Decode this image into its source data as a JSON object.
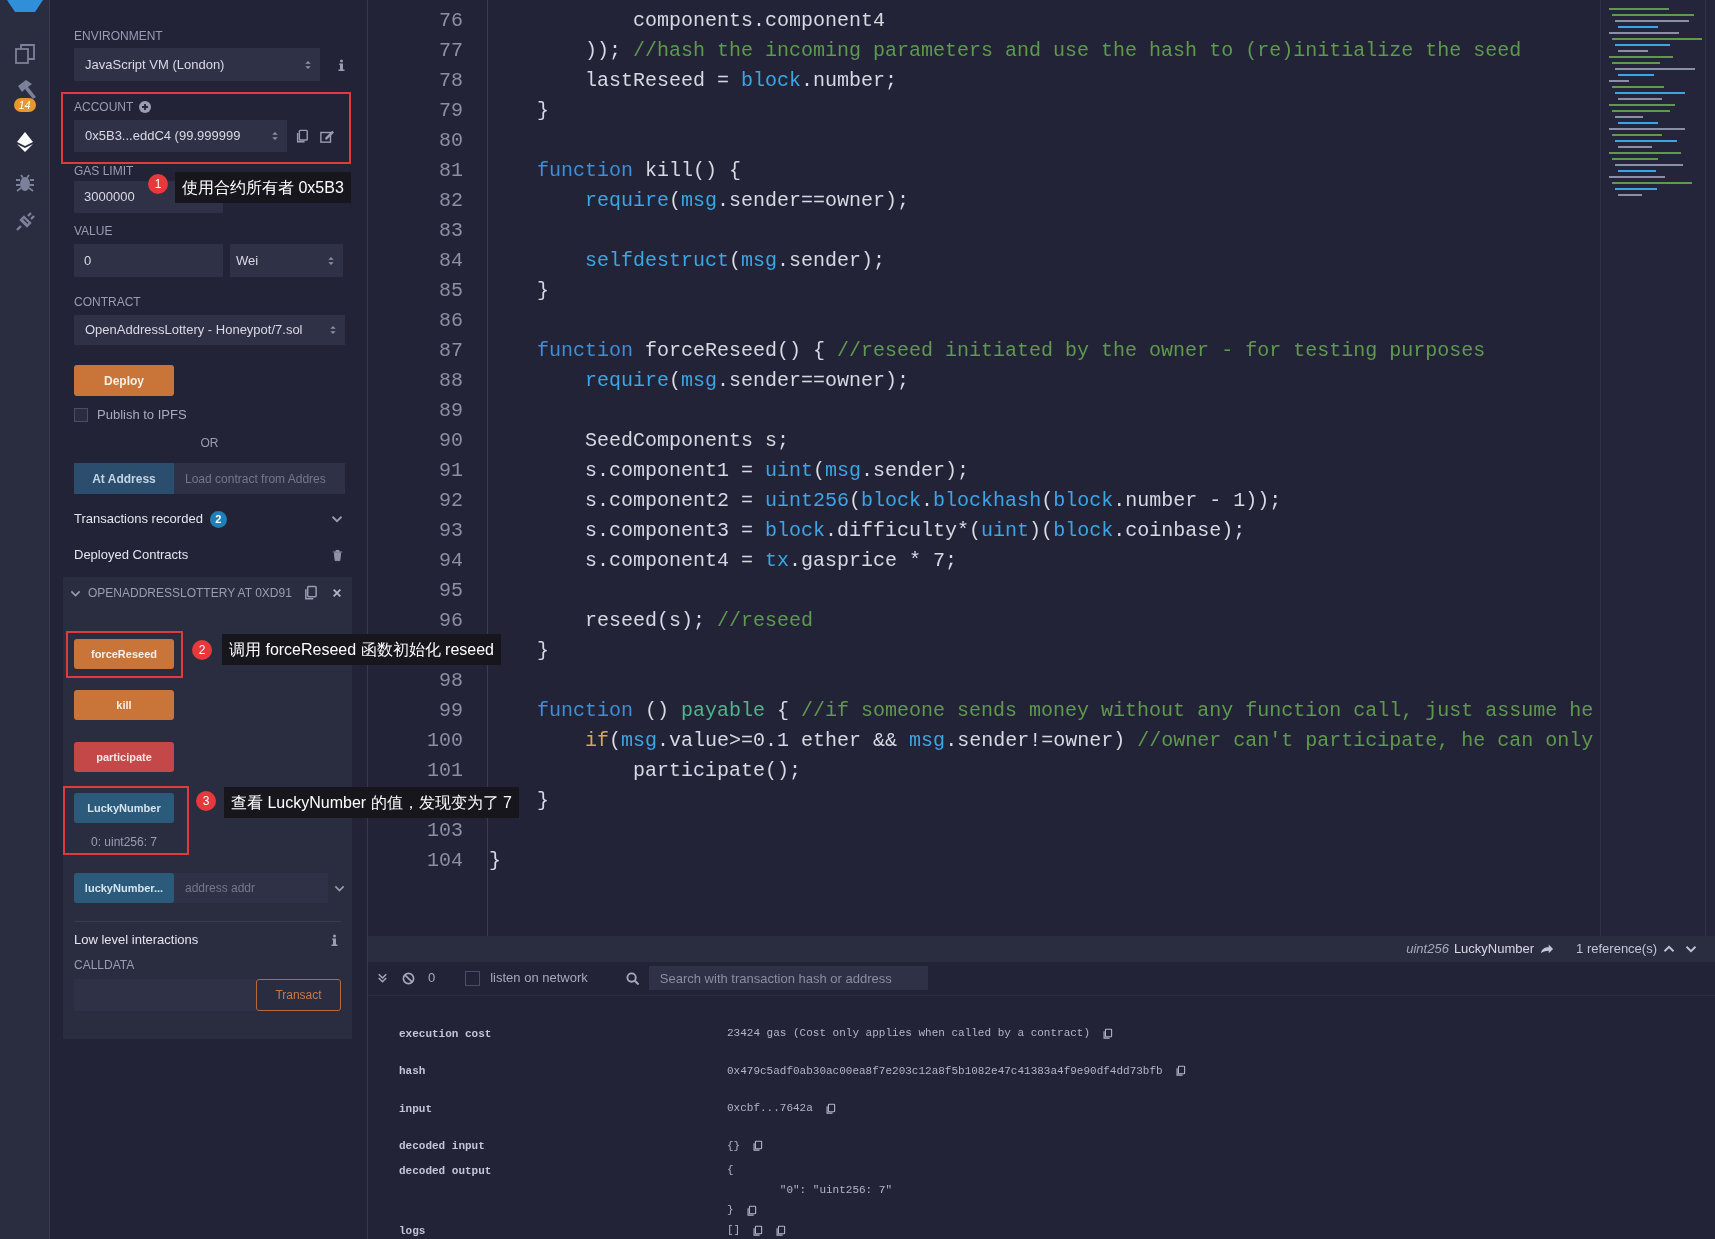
{
  "icon_bar": {
    "items": [
      {
        "kind": "files",
        "selected": false
      },
      {
        "kind": "compiler",
        "selected": false,
        "badge": "14"
      },
      {
        "kind": "deploy",
        "selected": true
      },
      {
        "kind": "debugger",
        "selected": false
      },
      {
        "kind": "plugins",
        "selected": false
      }
    ]
  },
  "run_panel": {
    "environment": {
      "label": "ENVIRONMENT",
      "value": "JavaScript VM (London)"
    },
    "account": {
      "label": "ACCOUNT",
      "value": "0x5B3...eddC4 (99.999999",
      "highlighted": true
    },
    "gas_limit": {
      "label": "GAS LIMIT",
      "value": "3000000"
    },
    "value": {
      "label": "VALUE",
      "value": "0",
      "unit": "Wei"
    },
    "contract": {
      "label": "CONTRACT",
      "value": "OpenAddressLottery - Honeypot/7.sol"
    },
    "deploy_button": "Deploy",
    "publish_ipfs": {
      "label": "Publish to IPFS",
      "checked": false
    },
    "or_text": "OR",
    "at_address": {
      "button": "At Address",
      "placeholder": "Load contract from Addres"
    },
    "transactions_recorded": {
      "label": "Transactions recorded",
      "count": "2"
    },
    "deployed_contracts": {
      "label": "Deployed Contracts"
    },
    "instance": {
      "title": "OPENADDRESSLOTTERY AT 0XD91",
      "expanded": true,
      "functions": [
        {
          "label": "forceReseed",
          "kind": "transact",
          "highlighted": true
        },
        {
          "label": "kill",
          "kind": "transact",
          "highlighted": false
        },
        {
          "label": "participate",
          "kind": "payable",
          "highlighted": false
        },
        {
          "label": "LuckyNumber",
          "kind": "call",
          "highlighted": true,
          "result": "0: uint256: 7"
        },
        {
          "label": "luckyNumber...",
          "kind": "call",
          "highlighted": false,
          "placeholder": "address addr"
        }
      ]
    },
    "low_level": {
      "title": "Low level interactions",
      "calldata_label": "CALLDATA",
      "transact_button": "Transact"
    }
  },
  "annotations": [
    {
      "number": "1",
      "text": "使用合约所有者 0x5B3"
    },
    {
      "number": "2",
      "text": "调用 forceReseed 函数初始化 reseed"
    },
    {
      "number": "3",
      "text": "查看 LuckyNumber 的值，发现变为了 7"
    }
  ],
  "editor": {
    "lines": [
      {
        "number": "76",
        "tokens": [
          {
            "text": "            components.component4",
            "kind": "plain"
          }
        ]
      },
      {
        "number": "77",
        "tokens": [
          {
            "text": "        )); ",
            "kind": "plain"
          },
          {
            "text": "//hash the incoming parameters and use the hash to (re)initialize the seed",
            "kind": "comment"
          }
        ]
      },
      {
        "number": "78",
        "tokens": [
          {
            "text": "        lastReseed = ",
            "kind": "plain"
          },
          {
            "text": "block",
            "kind": "builtin"
          },
          {
            "text": ".number;",
            "kind": "plain"
          }
        ]
      },
      {
        "number": "79",
        "tokens": [
          {
            "text": "    }",
            "kind": "plain"
          }
        ]
      },
      {
        "number": "80"
      },
      {
        "number": "81",
        "tokens": [
          {
            "text": "    function",
            "kind": "keyword"
          },
          {
            "text": " kill() {",
            "kind": "plain"
          }
        ]
      },
      {
        "number": "82",
        "tokens": [
          {
            "text": "        require",
            "kind": "builtin"
          },
          {
            "text": "(",
            "kind": "plain"
          },
          {
            "text": "msg",
            "kind": "builtin"
          },
          {
            "text": ".sender==owner);",
            "kind": "plain"
          }
        ]
      },
      {
        "number": "83"
      },
      {
        "number": "84",
        "tokens": [
          {
            "text": "        selfdestruct",
            "kind": "builtin"
          },
          {
            "text": "(",
            "kind": "plain"
          },
          {
            "text": "msg",
            "kind": "builtin"
          },
          {
            "text": ".sender);",
            "kind": "plain"
          }
        ]
      },
      {
        "number": "85",
        "tokens": [
          {
            "text": "    }",
            "kind": "plain"
          }
        ]
      },
      {
        "number": "86"
      },
      {
        "number": "87",
        "tokens": [
          {
            "text": "    function",
            "kind": "keyword"
          },
          {
            "text": " forceReseed() { ",
            "kind": "plain"
          },
          {
            "text": "//reseed initiated by the owner - for testing purposes",
            "kind": "comment"
          }
        ]
      },
      {
        "number": "88",
        "tokens": [
          {
            "text": "        require",
            "kind": "builtin"
          },
          {
            "text": "(",
            "kind": "plain"
          },
          {
            "text": "msg",
            "kind": "builtin"
          },
          {
            "text": ".sender==owner);",
            "kind": "plain"
          }
        ]
      },
      {
        "number": "89"
      },
      {
        "number": "90",
        "tokens": [
          {
            "text": "        SeedComponents s;",
            "kind": "plain"
          }
        ]
      },
      {
        "number": "91",
        "tokens": [
          {
            "text": "        s.component1 = ",
            "kind": "plain"
          },
          {
            "text": "uint",
            "kind": "builtin"
          },
          {
            "text": "(",
            "kind": "plain"
          },
          {
            "text": "msg",
            "kind": "builtin"
          },
          {
            "text": ".sender);",
            "kind": "plain"
          }
        ]
      },
      {
        "number": "92",
        "tokens": [
          {
            "text": "        s.component2 = ",
            "kind": "plain"
          },
          {
            "text": "uint256",
            "kind": "builtin"
          },
          {
            "text": "(",
            "kind": "plain"
          },
          {
            "text": "block",
            "kind": "builtin"
          },
          {
            "text": ".",
            "kind": "plain"
          },
          {
            "text": "blockhash",
            "kind": "builtin"
          },
          {
            "text": "(",
            "kind": "plain"
          },
          {
            "text": "block",
            "kind": "builtin"
          },
          {
            "text": ".number - 1));",
            "kind": "plain"
          }
        ]
      },
      {
        "number": "93",
        "tokens": [
          {
            "text": "        s.component3 = ",
            "kind": "plain"
          },
          {
            "text": "block",
            "kind": "builtin"
          },
          {
            "text": ".difficulty*(",
            "kind": "plain"
          },
          {
            "text": "uint",
            "kind": "builtin"
          },
          {
            "text": ")(",
            "kind": "plain"
          },
          {
            "text": "block",
            "kind": "builtin"
          },
          {
            "text": ".coinbase);",
            "kind": "plain"
          }
        ]
      },
      {
        "number": "94",
        "tokens": [
          {
            "text": "        s.component4 = ",
            "kind": "plain"
          },
          {
            "text": "tx",
            "kind": "builtin"
          },
          {
            "text": ".gasprice * 7;",
            "kind": "plain"
          }
        ]
      },
      {
        "number": "95"
      },
      {
        "number": "96",
        "tokens": [
          {
            "text": "        reseed(s); ",
            "kind": "plain"
          },
          {
            "text": "//reseed",
            "kind": "comment"
          }
        ]
      },
      {
        "tokens": [
          {
            "text": "    }",
            "kind": "plain"
          }
        ]
      },
      {
        "number": "98"
      },
      {
        "number": "99",
        "tokens": [
          {
            "text": "    function",
            "kind": "keyword"
          },
          {
            "text": " () ",
            "kind": "plain"
          },
          {
            "text": "payable",
            "kind": "modifier"
          },
          {
            "text": " { ",
            "kind": "plain"
          },
          {
            "text": "//if someone sends money without any function call, just assume he",
            "kind": "comment"
          }
        ]
      },
      {
        "number": "100",
        "tokens": [
          {
            "text": "        if",
            "kind": "control"
          },
          {
            "text": "(",
            "kind": "plain"
          },
          {
            "text": "msg",
            "kind": "builtin"
          },
          {
            "text": ".value>=0.1 ether && ",
            "kind": "plain"
          },
          {
            "text": "msg",
            "kind": "builtin"
          },
          {
            "text": ".sender!=owner) ",
            "kind": "plain"
          },
          {
            "text": "//owner can't participate, he can only",
            "kind": "comment"
          }
        ]
      },
      {
        "number": "101",
        "tokens": [
          {
            "text": "            participate();",
            "kind": "plain"
          }
        ]
      },
      {
        "tokens": [
          {
            "text": "    }",
            "kind": "plain"
          }
        ]
      },
      {
        "number": "103"
      },
      {
        "number": "104",
        "tokens": [
          {
            "text": "}",
            "kind": "plain"
          }
        ]
      }
    ]
  },
  "reference_bar": {
    "type": "uint256",
    "name": "LuckyNumber",
    "references": "1 reference(s)"
  },
  "terminal": {
    "pending_count": "0",
    "listen": {
      "label": "listen on network",
      "checked": false
    },
    "search_placeholder": "Search with transaction hash or address",
    "rows": [
      {
        "label": "execution cost",
        "lines": [
          "23424 gas (Cost only applies when called by a contract)"
        ],
        "kind": "single_copy"
      },
      {
        "label": "hash",
        "lines": [
          "0x479c5adf0ab30ac00ea8f7e203c12a8f5b1082e47c41383a4f9e90df4dd73bfb"
        ],
        "kind": "single_copy"
      },
      {
        "label": "input",
        "lines": [
          "0xcbf...7642a"
        ],
        "kind": "single_copy"
      },
      {
        "label": "decoded input",
        "lines": [
          "{}"
        ],
        "kind": "single_copy"
      },
      {
        "label": "decoded output",
        "lines": [
          "{",
          "        \"0\": \"uint256: 7\"",
          "}"
        ],
        "kind": "single_copy"
      },
      {
        "label": "logs",
        "lines": [
          "[]"
        ],
        "kind": "double_copy"
      }
    ]
  }
}
